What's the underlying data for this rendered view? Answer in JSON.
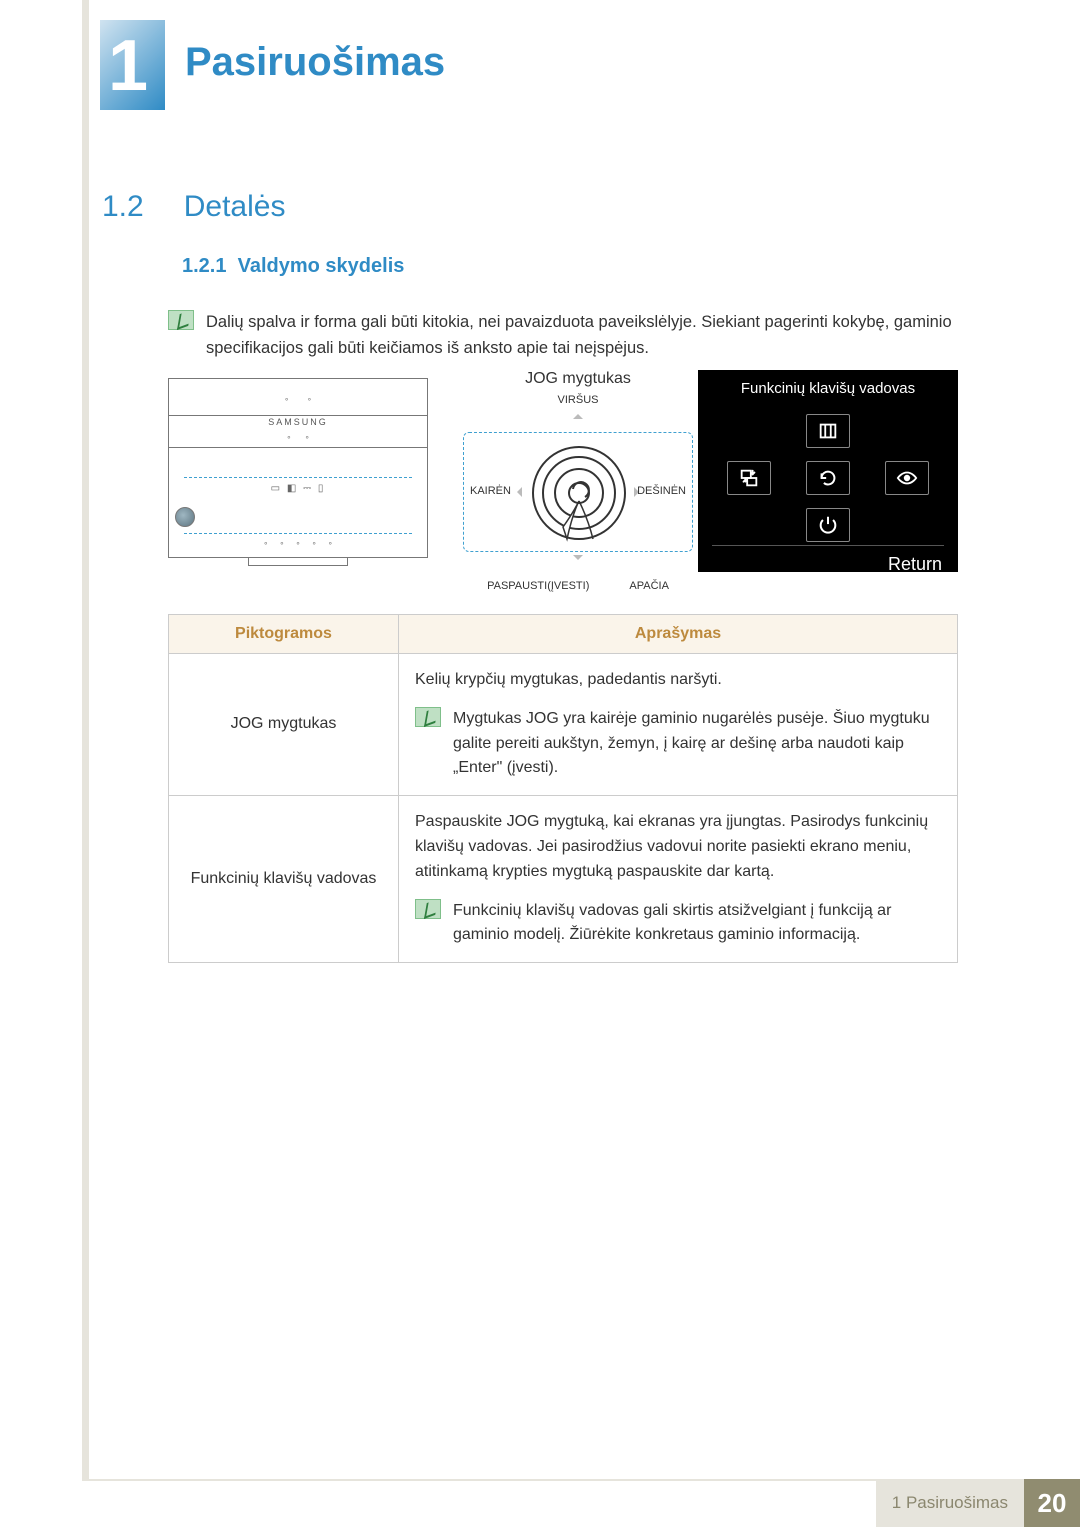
{
  "chapter": {
    "number": "1",
    "title": "Pasiruošimas"
  },
  "section": {
    "number": "1.2",
    "title": "Detalės"
  },
  "subsection": {
    "number": "1.2.1",
    "title": "Valdymo skydelis"
  },
  "top_note": "Dalių spalva ir forma gali būti kitokia, nei pavaizduota paveikslėlyje. Siekiant pagerinti kokybę, gaminio specifikacijos gali būti keičiamos iš anksto apie tai neįspėjus.",
  "diagram": {
    "monitor_brand": "SAMSUNG",
    "jog_label": "JOG mygtukas",
    "dir_top": "VIRŠUS",
    "dir_left": "KAIRĖN",
    "dir_right": "DEŠINĖN",
    "dir_bottom": "APAČIA",
    "press_label": "PASPAUSTI(ĮVESTI)",
    "osd_title": "Funkcinių klavišų vadovas",
    "osd_return": "Return"
  },
  "table": {
    "header_icons": "Piktogramos",
    "header_desc": "Aprašymas",
    "rows": {
      "row1": {
        "icon_label": "JOG mygtukas",
        "desc": "Kelių krypčių mygtukas, padedantis naršyti.",
        "note": "Mygtukas JOG yra kairėje gaminio nugarėlės pusėje. Šiuo mygtuku galite pereiti aukštyn, žemyn, į kairę ar dešinę arba naudoti kaip „Enter\" (įvesti)."
      },
      "row2": {
        "icon_label": "Funkcinių klavišų vadovas",
        "desc": "Paspauskite JOG mygtuką, kai ekranas yra įjungtas. Pasirodys funkcinių klavišų vadovas. Jei pasirodžius vadovui norite pasiekti ekrano meniu, atitinkamą krypties mygtuką paspauskite dar kartą.",
        "note": "Funkcinių klavišų vadovas gali skirtis atsižvelgiant į funkciją ar gaminio modelį. Žiūrėkite konkretaus gaminio informaciją."
      }
    }
  },
  "footer": {
    "label": "1 Pasiruošimas",
    "page": "20"
  }
}
